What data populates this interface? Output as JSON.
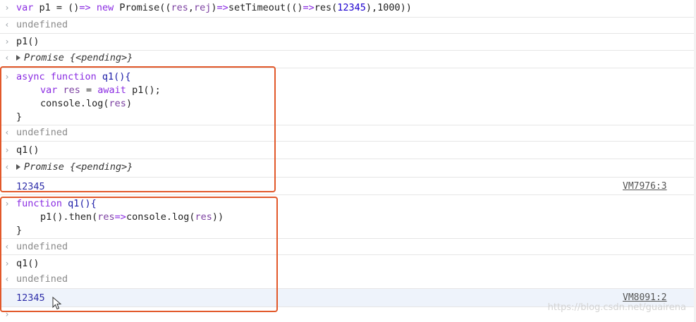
{
  "console": {
    "prefix_input": "›",
    "prefix_output": "‹",
    "entries": {
      "p1_def": {
        "var": "var",
        "name": " p1 = ()",
        "arrow": "=>",
        "new": " new",
        "rest_a": " Promise((",
        "res": "res",
        "comma": ",",
        "rej": "rej",
        "rest_b": ")",
        "arrow2": "=>",
        "rest_c": "setTimeout(()",
        "arrow3": "=>",
        "rest_d": "res(",
        "num": "12345",
        "rest_e": "),1000))"
      },
      "undefined_1": "undefined",
      "p1_call": "p1()",
      "promise_1": "Promise {<pending>}",
      "async_fn": {
        "l1_async": "async",
        "l1_function": " function",
        "l1_name": " q1(){",
        "l2_var": "var",
        "l2_res": " res",
        "l2_eq": " = ",
        "l2_await": "await",
        "l2_rest": " p1();",
        "l3_a": "console.log(",
        "l3_res": "res",
        "l3_b": ")",
        "l4": "}"
      },
      "undefined_2": "undefined",
      "q1_call_1": "q1()",
      "promise_2": "Promise {<pending>}",
      "log_1": {
        "value": "12345",
        "source": "VM7976:3"
      },
      "then_fn": {
        "l1_function": "function",
        "l1_name": " q1(){",
        "l2_a": "p1().then(",
        "l2_res": "res",
        "l2_arrow": "=>",
        "l2_b": "console.log(",
        "l2_res2": "res",
        "l2_c": "))",
        "l3": "}"
      },
      "undefined_3": "undefined",
      "q1_call_2": "q1()",
      "undefined_4": "undefined",
      "log_2": {
        "value": "12345",
        "source": "VM8091:2"
      }
    },
    "watermark": "https://blog.csdn.net/guairena"
  },
  "colors": {
    "highlight_box": "#e2582a",
    "keyword": "#8a2be2",
    "log_value": "#2d2da8"
  }
}
